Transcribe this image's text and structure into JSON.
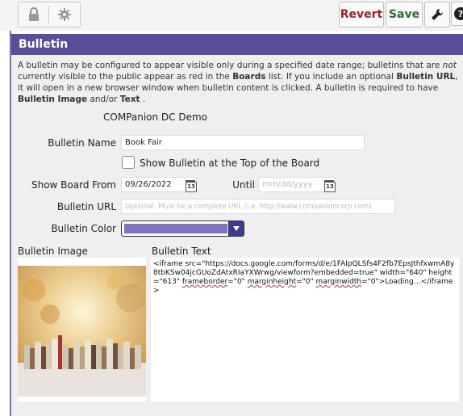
{
  "toolbar": {
    "revert_label": "Revert",
    "save_label": "Save"
  },
  "header": {
    "title": "Bulletin"
  },
  "description": {
    "part1": "A bulletin may be configured to appear visible only during a specified date range; bulletins that are ",
    "not": "not",
    "part2": " currently visible to the public appear as red in the ",
    "boards": "Boards",
    "part3": " list. If you include an optional ",
    "bulletin_url": "Bulletin URL",
    "part4": ", it will open in a new browser window when bulletin content is clicked. A bulletin is required to have ",
    "bulletin_image": "Bulletin Image",
    "part5": " and/or ",
    "text": "Text",
    "part6": " ."
  },
  "form": {
    "org_name": "COMPanion DC Demo",
    "bulletin_name_label": "Bulletin Name",
    "bulletin_name_value": "Book Fair",
    "show_top_label": "Show Bulletin at the Top of the Board",
    "show_from_label": "Show Board From",
    "show_from_value": "09/26/2022",
    "until_label": "Until",
    "until_placeholder": "mm/dd/yyyy",
    "calendar_day": "13",
    "url_label": "Bulletin URL",
    "url_placeholder": "Optional. Must be a complete URL (i.e. http://www.companioncorp.com)",
    "color_label": "Bulletin Color",
    "color_value": "#7c73c2"
  },
  "image_section": {
    "label": "Bulletin Image"
  },
  "text_section": {
    "label": "Bulletin Text",
    "line1": "<iframe src=\"https://docs.google.com/forms/d/e/1FAIpQLSfs4F2fb7EpsJthfxwmA8y8tbKSw04jcGUoZdAtxRIaYXWrwg/viewform?embedded=true\" width=\"640\" height=\"613\" ",
    "frameborder": "frameborder",
    "mid1": "=\"0\" ",
    "marginheight": "marginheight",
    "mid2": "=\"0\" ",
    "marginwidth": "marginwidth",
    "tail": "=\"0\">Loading…</iframe>"
  },
  "colors": {
    "header": "#5b4e99",
    "accent_red": "#a3202a",
    "accent_green": "#2e6b2e"
  },
  "icons": [
    "lock-icon",
    "gear-icon",
    "wrench-icon",
    "help-icon",
    "calendar-icon",
    "chevron-down-icon"
  ]
}
